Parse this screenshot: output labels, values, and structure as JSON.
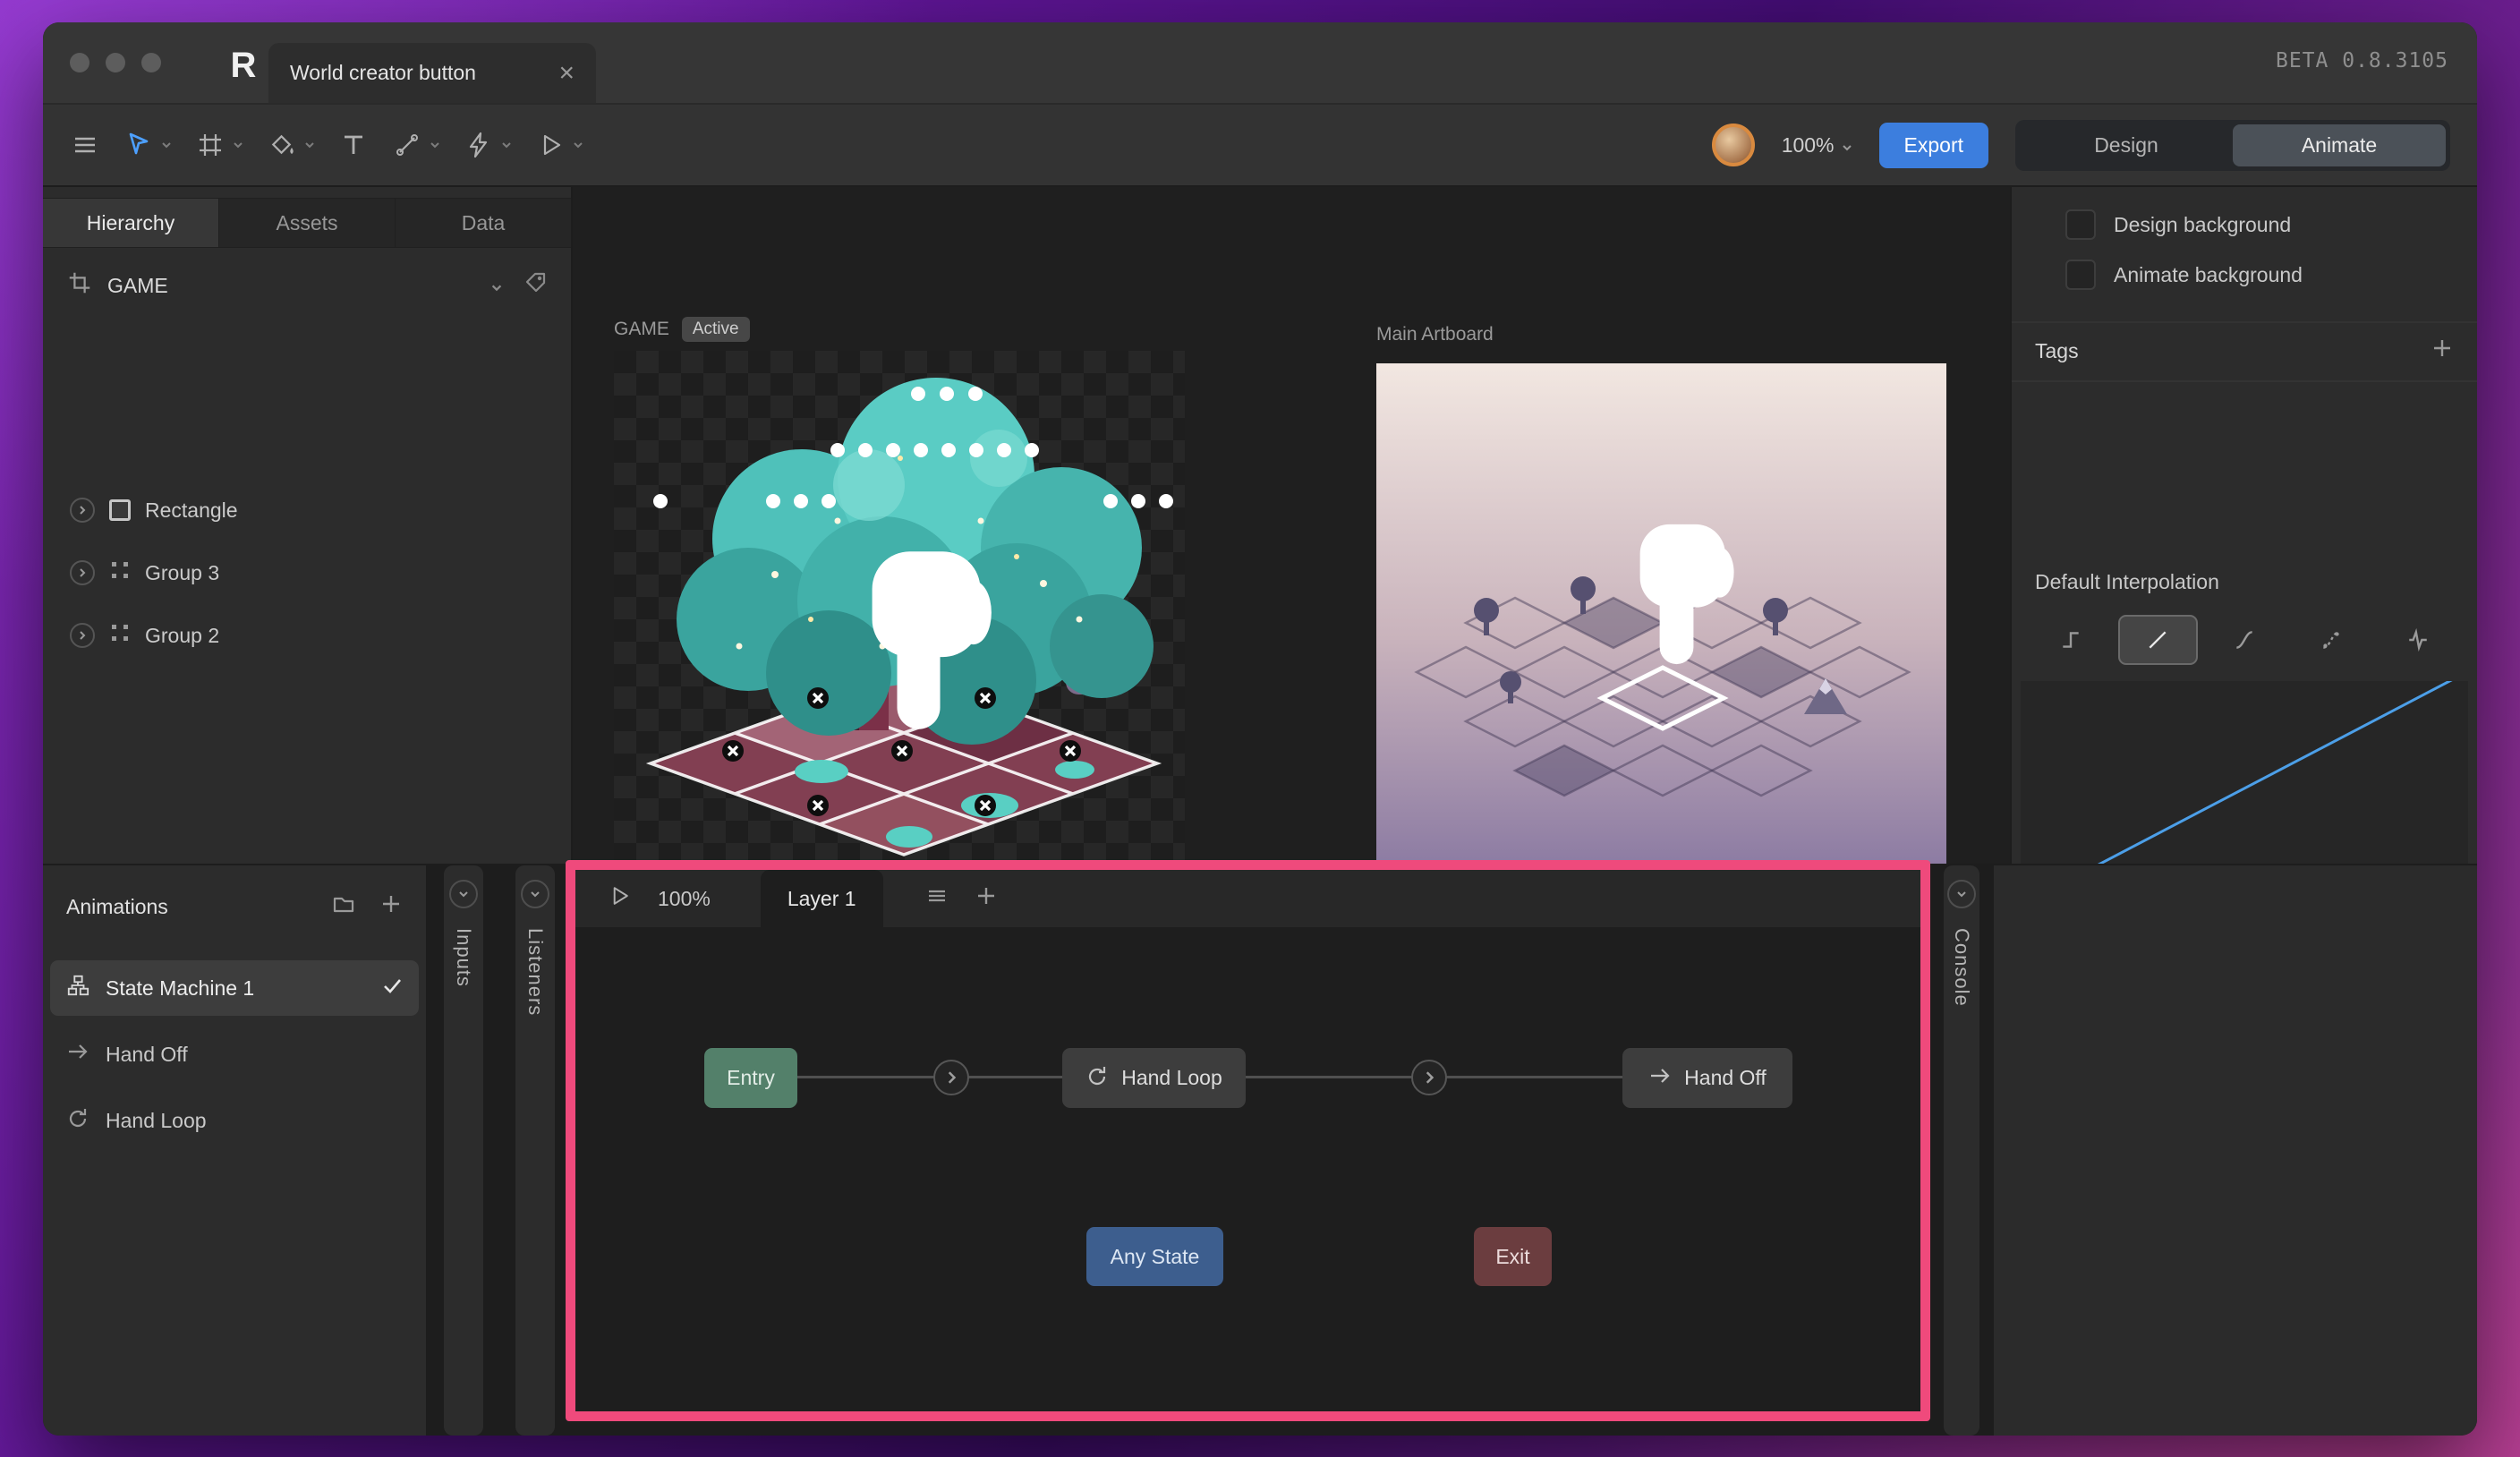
{
  "window": {
    "tab_title": "World creator button",
    "beta_label": "BETA 0.8.3105",
    "close_glyph": "×"
  },
  "toolbar": {
    "zoom": "100%",
    "export": "Export",
    "design": "Design",
    "animate": "Animate"
  },
  "hierarchy": {
    "tabs": [
      {
        "label": "Hierarchy"
      },
      {
        "label": "Assets"
      },
      {
        "label": "Data"
      }
    ],
    "artboard": "GAME",
    "items": [
      {
        "label": "Rectangle"
      },
      {
        "label": "Group 3"
      },
      {
        "label": "Group 2"
      }
    ]
  },
  "stage": {
    "artboard_name": "GAME",
    "active_badge": "Active",
    "main_artboard_label": "Main Artboard"
  },
  "inspector": {
    "design_background": "Design background",
    "animate_background": "Animate background",
    "tags": "Tags",
    "default_interpolation": "Default Interpolation"
  },
  "animations": {
    "title": "Animations",
    "items": [
      {
        "label": "State Machine 1"
      },
      {
        "label": "Hand Off"
      },
      {
        "label": "Hand Loop"
      }
    ]
  },
  "strips": {
    "inputs": "Inputs",
    "listeners": "Listeners",
    "console": "Console"
  },
  "state_machine": {
    "zoom": "100%",
    "layer": "Layer 1",
    "entry": "Entry",
    "hand_loop": "Hand Loop",
    "hand_off": "Hand Off",
    "any_state": "Any State",
    "exit": "Exit"
  },
  "colors": {
    "accent_blue": "#3C7EDE",
    "annotation_pink": "#EF4A7C",
    "entry_green": "#53806A",
    "any_state_blue": "#3D5E8E",
    "exit_red": "#6B3D3F",
    "state_gray": "#3D3D3D",
    "interpolation_curve_blue": "#4C9FE8",
    "avatar_ring_orange": "#D98A3F"
  }
}
